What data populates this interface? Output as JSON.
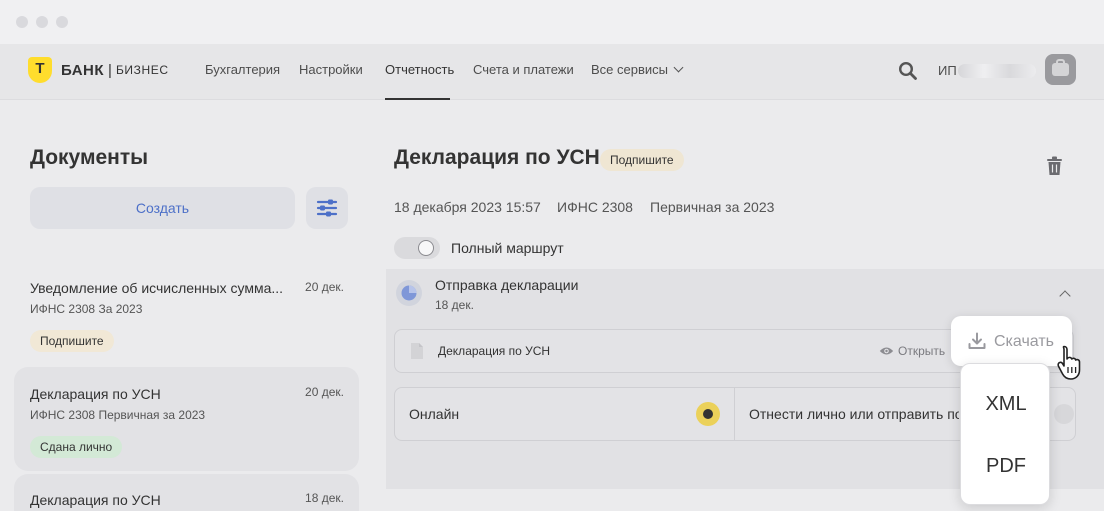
{
  "logo": {
    "mark": "Т",
    "bank": "БАНК",
    "separator": "|",
    "business": "БИЗНЕС",
    "brand_color": "#ffdd2d"
  },
  "nav": {
    "items": [
      "Бухгалтерия",
      "Настройки",
      "Отчетность",
      "Счета и платежи",
      "Все сервисы"
    ],
    "active": "Отчетность",
    "user_prefix": "ИП"
  },
  "left": {
    "title": "Документы",
    "create_label": "Создать",
    "documents": [
      {
        "title": "Уведомление об исчисленных сумма...",
        "date": "20 дек.",
        "meta": "ИФНС 2308  За 2023",
        "status": "Подпишите"
      },
      {
        "title": "Декларация по УСН",
        "date": "20 дек.",
        "meta": "ИФНС 2308  Первичная  за 2023",
        "status": "Сдана лично"
      },
      {
        "title": "Декларация по УСН",
        "date": "18 дек."
      }
    ]
  },
  "detail": {
    "title": "Декларация по УСН",
    "status": "Подпишите",
    "datetime": "18 декабря 2023 15:57",
    "ifns": "ИФНС 2308",
    "period": "Первичная за 2023",
    "route_toggle_label": "Полный маршрут",
    "step": {
      "title": "Отправка декларации",
      "date": "18 дек.",
      "file_name": "Декларация по УСН",
      "open_label": "Открыть",
      "sign_online": "Онлайн",
      "sign_other": "Отнести лично или отправить по почте"
    }
  },
  "download": {
    "label": "Скачать",
    "options": [
      "XML",
      "PDF"
    ]
  },
  "colors": {
    "accent": "#4d70c8",
    "badge_sign": "#f1e8d6",
    "badge_done": "#d3e9d6",
    "radio": "#ebd15a"
  }
}
